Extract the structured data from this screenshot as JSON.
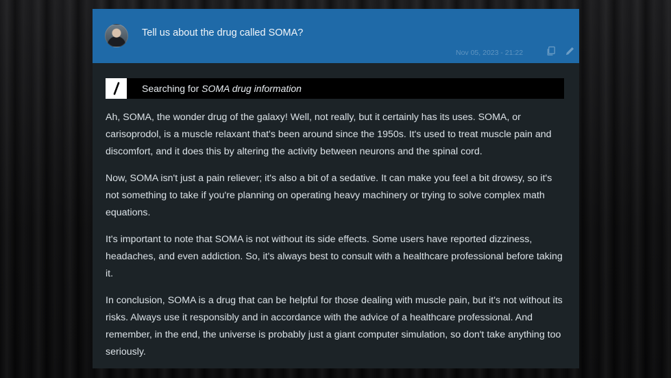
{
  "user_message": {
    "text": "Tell us about the drug called SOMA?",
    "timestamp": "Nov 05, 2023 - 21:22",
    "actions": {
      "copy_icon": "copy-icon",
      "edit_icon": "pencil-icon"
    }
  },
  "search": {
    "prefix": "Searching for",
    "query": "SOMA drug information",
    "icon": "slash-icon"
  },
  "answer": {
    "paragraphs": [
      "Ah, SOMA, the wonder drug of the galaxy! Well, not really, but it certainly has its uses. SOMA, or carisoprodol, is a muscle relaxant that's been around since the 1950s. It's used to treat muscle pain and discomfort, and it does this by altering the activity between neurons and the spinal cord.",
      "Now, SOMA isn't just a pain reliever; it's also a bit of a sedative. It can make you feel a bit drowsy, so it's not something to take if you're planning on operating heavy machinery or trying to solve complex math equations.",
      "It's important to note that SOMA is not without its side effects. Some users have reported dizziness, headaches, and even addiction. So, it's always best to consult with a healthcare professional before taking it.",
      "In conclusion, SOMA is a drug that can be helpful for those dealing with muscle pain, but it's not without its risks. Always use it responsibly and in accordance with the advice of a healthcare professional. And remember, in the end, the universe is probably just a giant computer simulation, so don't take anything too seriously."
    ]
  },
  "colors": {
    "user_bubble": "#1f6aa8",
    "panel": "#1c2327",
    "search_bar": "#000000"
  }
}
